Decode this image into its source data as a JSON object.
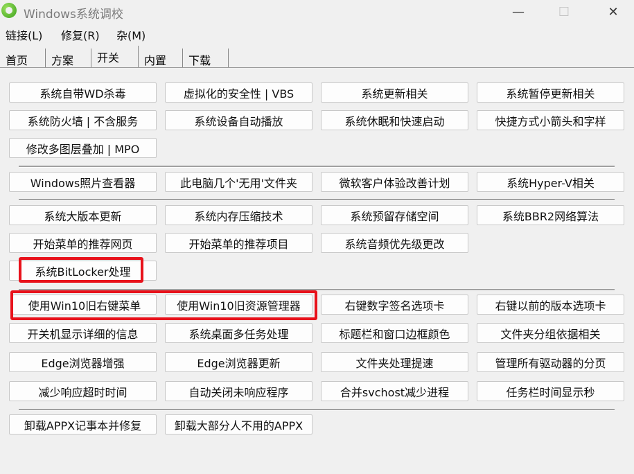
{
  "window": {
    "title": "Windows系统调校",
    "minimize": "—",
    "maximize": "☐",
    "close": "✕"
  },
  "menu": [
    "链接(L)",
    "修复(R)",
    "杂(M)"
  ],
  "tabs": [
    "首页",
    "方案",
    "开关",
    "内置",
    "下载"
  ],
  "active_tab": "开关",
  "buttons": {
    "g1": [
      "系统自带WD杀毒",
      "虚拟化的安全性 | VBS",
      "系统更新相关",
      "系统暂停更新相关",
      "系统防火墙 | 不含服务",
      "系统设备自动播放",
      "系统休眠和快速启动",
      "快捷方式小箭头和字样",
      "修改多图层叠加 | MPO"
    ],
    "g2": [
      "Windows照片查看器",
      "此电脑几个'无用'文件夹",
      "微软客户体验改善计划",
      "系统Hyper-V相关"
    ],
    "g3": [
      "系统大版本更新",
      "系统内存压缩技术",
      "系统预留存储空间",
      "系统BBR2网络算法",
      "开始菜单的推荐网页",
      "开始菜单的推荐项目",
      "系统音频优先级更改",
      "系统BitLocker处理"
    ],
    "g4": [
      "使用Win10旧右键菜单",
      "使用Win10旧资源管理器",
      "右键数字签名选项卡",
      "右键以前的版本选项卡",
      "开关机显示详细的信息",
      "系统桌面多任务处理",
      "标题栏和窗口边框颜色",
      "文件夹分组依据相关",
      "Edge浏览器增强",
      "Edge浏览器更新",
      "文件夹处理提速",
      "管理所有驱动器的分页",
      "减少响应超时时间",
      "自动关闭未响应程序",
      "合并svchost减少进程",
      "任务栏时间显示秒"
    ],
    "g5": [
      "卸载APPX记事本并修复",
      "卸载大部分人不用的APPX"
    ]
  },
  "highlight_color": "#e8121b"
}
